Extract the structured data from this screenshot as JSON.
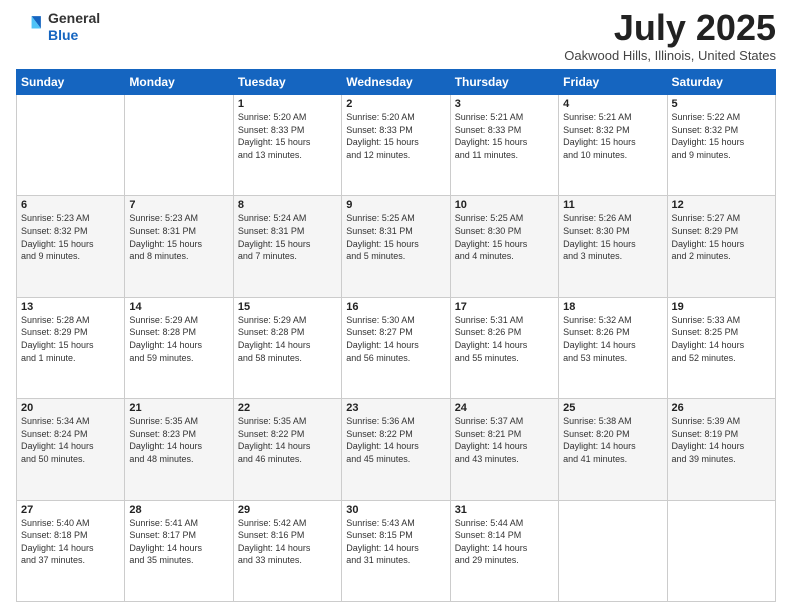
{
  "header": {
    "logo_line1": "General",
    "logo_line2": "Blue",
    "month": "July 2025",
    "location": "Oakwood Hills, Illinois, United States"
  },
  "weekdays": [
    "Sunday",
    "Monday",
    "Tuesday",
    "Wednesday",
    "Thursday",
    "Friday",
    "Saturday"
  ],
  "weeks": [
    [
      {
        "day": "",
        "info": ""
      },
      {
        "day": "",
        "info": ""
      },
      {
        "day": "1",
        "info": "Sunrise: 5:20 AM\nSunset: 8:33 PM\nDaylight: 15 hours\nand 13 minutes."
      },
      {
        "day": "2",
        "info": "Sunrise: 5:20 AM\nSunset: 8:33 PM\nDaylight: 15 hours\nand 12 minutes."
      },
      {
        "day": "3",
        "info": "Sunrise: 5:21 AM\nSunset: 8:33 PM\nDaylight: 15 hours\nand 11 minutes."
      },
      {
        "day": "4",
        "info": "Sunrise: 5:21 AM\nSunset: 8:32 PM\nDaylight: 15 hours\nand 10 minutes."
      },
      {
        "day": "5",
        "info": "Sunrise: 5:22 AM\nSunset: 8:32 PM\nDaylight: 15 hours\nand 9 minutes."
      }
    ],
    [
      {
        "day": "6",
        "info": "Sunrise: 5:23 AM\nSunset: 8:32 PM\nDaylight: 15 hours\nand 9 minutes."
      },
      {
        "day": "7",
        "info": "Sunrise: 5:23 AM\nSunset: 8:31 PM\nDaylight: 15 hours\nand 8 minutes."
      },
      {
        "day": "8",
        "info": "Sunrise: 5:24 AM\nSunset: 8:31 PM\nDaylight: 15 hours\nand 7 minutes."
      },
      {
        "day": "9",
        "info": "Sunrise: 5:25 AM\nSunset: 8:31 PM\nDaylight: 15 hours\nand 5 minutes."
      },
      {
        "day": "10",
        "info": "Sunrise: 5:25 AM\nSunset: 8:30 PM\nDaylight: 15 hours\nand 4 minutes."
      },
      {
        "day": "11",
        "info": "Sunrise: 5:26 AM\nSunset: 8:30 PM\nDaylight: 15 hours\nand 3 minutes."
      },
      {
        "day": "12",
        "info": "Sunrise: 5:27 AM\nSunset: 8:29 PM\nDaylight: 15 hours\nand 2 minutes."
      }
    ],
    [
      {
        "day": "13",
        "info": "Sunrise: 5:28 AM\nSunset: 8:29 PM\nDaylight: 15 hours\nand 1 minute."
      },
      {
        "day": "14",
        "info": "Sunrise: 5:29 AM\nSunset: 8:28 PM\nDaylight: 14 hours\nand 59 minutes."
      },
      {
        "day": "15",
        "info": "Sunrise: 5:29 AM\nSunset: 8:28 PM\nDaylight: 14 hours\nand 58 minutes."
      },
      {
        "day": "16",
        "info": "Sunrise: 5:30 AM\nSunset: 8:27 PM\nDaylight: 14 hours\nand 56 minutes."
      },
      {
        "day": "17",
        "info": "Sunrise: 5:31 AM\nSunset: 8:26 PM\nDaylight: 14 hours\nand 55 minutes."
      },
      {
        "day": "18",
        "info": "Sunrise: 5:32 AM\nSunset: 8:26 PM\nDaylight: 14 hours\nand 53 minutes."
      },
      {
        "day": "19",
        "info": "Sunrise: 5:33 AM\nSunset: 8:25 PM\nDaylight: 14 hours\nand 52 minutes."
      }
    ],
    [
      {
        "day": "20",
        "info": "Sunrise: 5:34 AM\nSunset: 8:24 PM\nDaylight: 14 hours\nand 50 minutes."
      },
      {
        "day": "21",
        "info": "Sunrise: 5:35 AM\nSunset: 8:23 PM\nDaylight: 14 hours\nand 48 minutes."
      },
      {
        "day": "22",
        "info": "Sunrise: 5:35 AM\nSunset: 8:22 PM\nDaylight: 14 hours\nand 46 minutes."
      },
      {
        "day": "23",
        "info": "Sunrise: 5:36 AM\nSunset: 8:22 PM\nDaylight: 14 hours\nand 45 minutes."
      },
      {
        "day": "24",
        "info": "Sunrise: 5:37 AM\nSunset: 8:21 PM\nDaylight: 14 hours\nand 43 minutes."
      },
      {
        "day": "25",
        "info": "Sunrise: 5:38 AM\nSunset: 8:20 PM\nDaylight: 14 hours\nand 41 minutes."
      },
      {
        "day": "26",
        "info": "Sunrise: 5:39 AM\nSunset: 8:19 PM\nDaylight: 14 hours\nand 39 minutes."
      }
    ],
    [
      {
        "day": "27",
        "info": "Sunrise: 5:40 AM\nSunset: 8:18 PM\nDaylight: 14 hours\nand 37 minutes."
      },
      {
        "day": "28",
        "info": "Sunrise: 5:41 AM\nSunset: 8:17 PM\nDaylight: 14 hours\nand 35 minutes."
      },
      {
        "day": "29",
        "info": "Sunrise: 5:42 AM\nSunset: 8:16 PM\nDaylight: 14 hours\nand 33 minutes."
      },
      {
        "day": "30",
        "info": "Sunrise: 5:43 AM\nSunset: 8:15 PM\nDaylight: 14 hours\nand 31 minutes."
      },
      {
        "day": "31",
        "info": "Sunrise: 5:44 AM\nSunset: 8:14 PM\nDaylight: 14 hours\nand 29 minutes."
      },
      {
        "day": "",
        "info": ""
      },
      {
        "day": "",
        "info": ""
      }
    ]
  ]
}
